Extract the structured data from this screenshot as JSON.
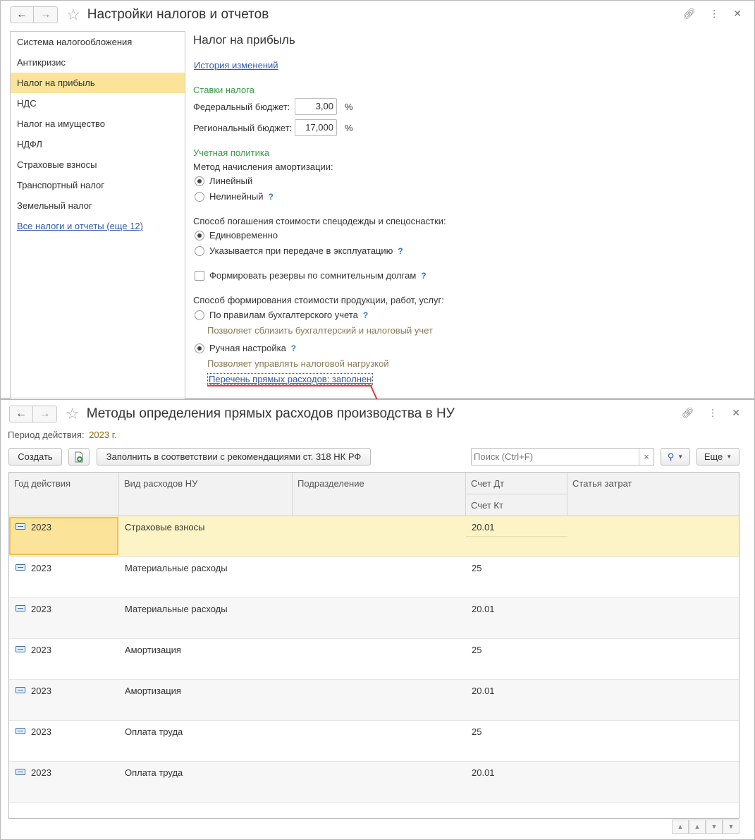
{
  "window1": {
    "title": "Настройки налогов и отчетов",
    "sidebar": {
      "items": [
        {
          "label": "Система налогообложения"
        },
        {
          "label": "Антикризис"
        },
        {
          "label": "Налог на прибыль"
        },
        {
          "label": "НДС"
        },
        {
          "label": "Налог на имущество"
        },
        {
          "label": "НДФЛ"
        },
        {
          "label": "Страховые взносы"
        },
        {
          "label": "Транспортный налог"
        },
        {
          "label": "Земельный налог"
        }
      ],
      "all_link": "Все налоги и отчеты (еще 12)"
    },
    "content": {
      "title": "Налог на прибыль",
      "history_link": "История изменений",
      "rates_header": "Ставки налога",
      "federal_label": "Федеральный бюджет:",
      "federal_value": "3,00",
      "regional_label": "Региональный бюджет:",
      "regional_value": "17,000",
      "percent": "%",
      "policy_header": "Учетная политика",
      "amort_label": "Метод начисления амортизации:",
      "amort_linear": "Линейный",
      "amort_nonlinear": "Нелинейный",
      "spec_label": "Способ погашения стоимости спецодежды и спецоснастки:",
      "spec_once": "Единовременно",
      "spec_transfer": "Указывается при передаче в эксплуатацию",
      "reserves_label": "Формировать резервы по сомнительным долгам",
      "cost_label": "Способ формирования стоимости продукции, работ, услуг:",
      "cost_acc_rules": "По правилам бухгалтерского учета",
      "cost_acc_hint": "Позволяет сблизить бухгалтерский и налоговый учет",
      "cost_manual": "Ручная настройка",
      "cost_manual_hint": "Позволяет управлять налоговой нагрузкой",
      "direct_link": "Перечень прямых расходов: заполнен",
      "q": "?"
    }
  },
  "window2": {
    "title": "Методы определения прямых расходов производства в НУ",
    "period_label": "Период действия:",
    "period_value": "2023 г.",
    "create_btn": "Создать",
    "fill_btn": "Заполнить в соответствии с рекомендациями ст. 318 НК РФ",
    "search_placeholder": "Поиск (Ctrl+F)",
    "more_btn": "Еще",
    "columns": {
      "year": "Год действия",
      "type": "Вид расходов НУ",
      "dept": "Подразделение",
      "dt": "Счет Дт",
      "kt": "Счет Кт",
      "cost_item": "Статья затрат"
    },
    "rows": [
      {
        "year": "2023",
        "type": "Страховые взносы",
        "dept": "",
        "dt": "20.01",
        "cost_item": ""
      },
      {
        "year": "2023",
        "type": "Материальные расходы",
        "dept": "",
        "dt": "25",
        "cost_item": ""
      },
      {
        "year": "2023",
        "type": "Материальные расходы",
        "dept": "",
        "dt": "20.01",
        "cost_item": ""
      },
      {
        "year": "2023",
        "type": "Амортизация",
        "dept": "",
        "dt": "25",
        "cost_item": ""
      },
      {
        "year": "2023",
        "type": "Амортизация",
        "dept": "",
        "dt": "20.01",
        "cost_item": ""
      },
      {
        "year": "2023",
        "type": "Оплата труда",
        "dept": "",
        "dt": "25",
        "cost_item": ""
      },
      {
        "year": "2023",
        "type": "Оплата труда",
        "dept": "",
        "dt": "20.01",
        "cost_item": ""
      }
    ]
  },
  "colors": {
    "accent_link": "#2f5aa8",
    "section_green": "#3a9a4a",
    "active_item": "#fbe49a",
    "selected_row": "#fcf3c6",
    "annotation_red": "#e0383f"
  }
}
